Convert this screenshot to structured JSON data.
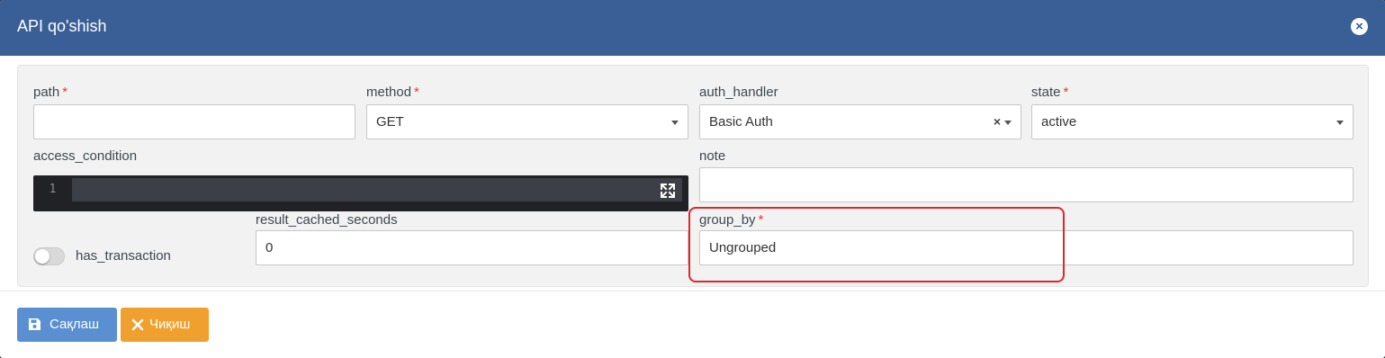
{
  "modal": {
    "title": "API qo'shish",
    "close_icon": "close-circle-icon"
  },
  "form": {
    "path": {
      "label": "path",
      "required": "*",
      "value": ""
    },
    "method": {
      "label": "method",
      "required": "*",
      "value": "GET"
    },
    "auth_handler": {
      "label": "auth_handler",
      "value": "Basic Auth",
      "clear": "×"
    },
    "state": {
      "label": "state",
      "required": "*",
      "value": "active"
    },
    "access_condition": {
      "label": "access_condition",
      "line_number": "1",
      "value": ""
    },
    "note": {
      "label": "note",
      "value": ""
    },
    "has_transaction": {
      "label": "has_transaction",
      "checked": false
    },
    "result_cached_seconds": {
      "label": "result_cached_seconds",
      "value": "0"
    },
    "group_by": {
      "label": "group_by",
      "required": "*",
      "value": "Ungrouped"
    }
  },
  "footer": {
    "save_label": "Сақлаш",
    "save_icon": "floppy-disk-icon",
    "exit_label": "Чиқиш",
    "exit_icon": "times-icon"
  },
  "colors": {
    "header": "#3a5f96",
    "save_button": "#5a8fd1",
    "exit_button": "#f0a02e",
    "highlight": "#e0262b"
  }
}
